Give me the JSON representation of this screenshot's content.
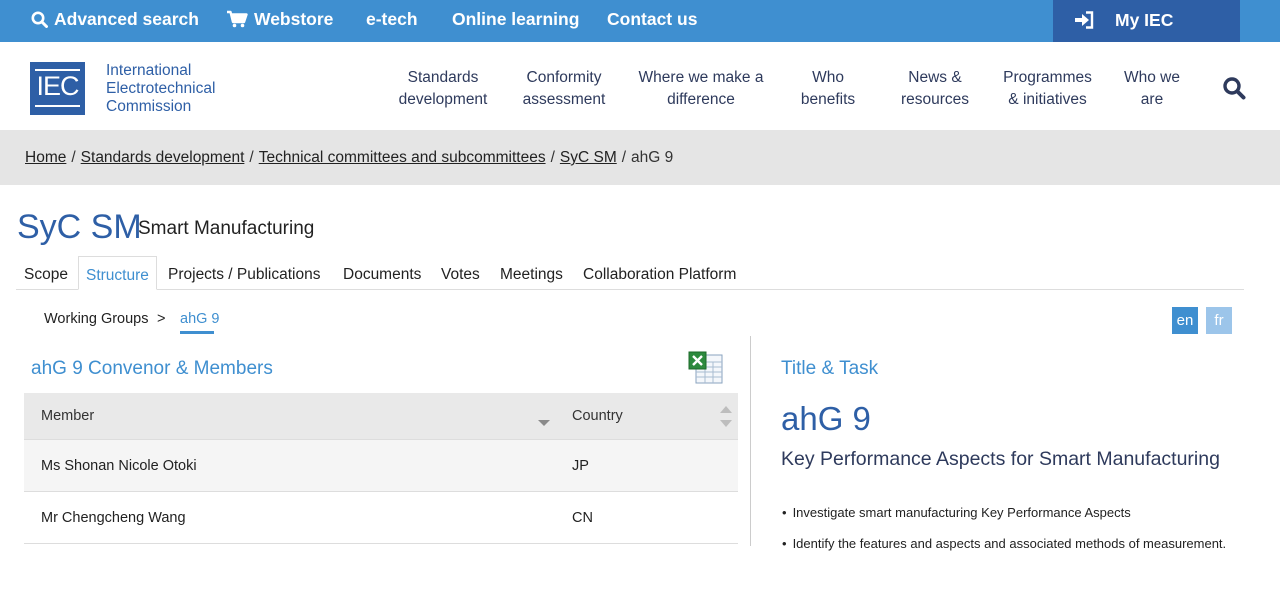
{
  "topbar": {
    "advanced_search": "Advanced search",
    "webstore": "Webstore",
    "etech": "e-tech",
    "online_learning": "Online learning",
    "contact_us": "Contact us",
    "my_iec": "My IEC"
  },
  "header": {
    "logo_text": "IEC",
    "org_line1": "International",
    "org_line2": "Electrotechnical",
    "org_line3": "Commission",
    "nav": [
      {
        "line1": "Standards",
        "line2": "development"
      },
      {
        "line1": "Conformity",
        "line2": "assessment"
      },
      {
        "line1": "Where we make a",
        "line2": "difference"
      },
      {
        "line1": "Who",
        "line2": "benefits"
      },
      {
        "line1": "News &",
        "line2": "resources"
      },
      {
        "line1": "Programmes",
        "line2": "& initiatives"
      },
      {
        "line1": "Who we",
        "line2": "are"
      }
    ]
  },
  "breadcrumb": {
    "items": [
      "Home",
      "Standards development",
      "Technical committees and subcommittees",
      "SyC SM"
    ],
    "current": "ahG 9",
    "separator": "/"
  },
  "committee": {
    "code": "SyC SM",
    "name": "Smart Manufacturing"
  },
  "tabs": [
    "Scope",
    "Structure",
    "Projects / Publications",
    "Documents",
    "Votes",
    "Meetings",
    "Collaboration Platform"
  ],
  "subnav": {
    "working_groups": "Working Groups",
    "separator": ">",
    "current": "ahG 9"
  },
  "languages": {
    "en": "en",
    "fr": "fr"
  },
  "members": {
    "title": "ahG 9 Convenor & Members",
    "columns": [
      "Member",
      "Country"
    ],
    "rows": [
      {
        "member": "Ms Shonan Nicole Otoki",
        "country": "JP"
      },
      {
        "member": "Mr Chengcheng Wang",
        "country": "CN"
      }
    ]
  },
  "title_task": {
    "heading": "Title & Task",
    "group": "ahG 9",
    "title": "Key Performance Aspects for Smart Manufacturing",
    "tasks": [
      "Investigate smart manufacturing Key Performance Aspects",
      "Identify the features and aspects and associated methods of measurement."
    ]
  },
  "colors": {
    "topbar": "#3f8fd0",
    "brand": "#2e5fa6",
    "accent": "#3f8fd0",
    "crumb_bg": "#e5e5e5"
  }
}
